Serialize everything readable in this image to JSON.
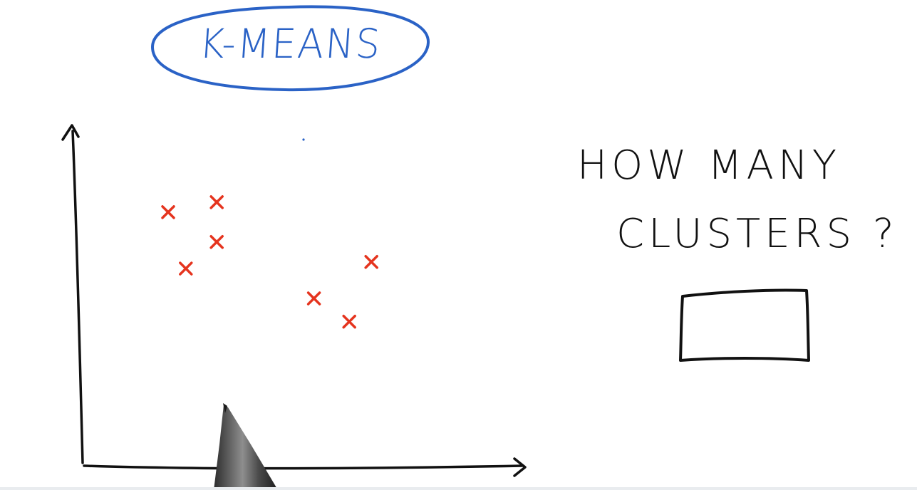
{
  "title": "K-MEANS",
  "question": {
    "line1": "HOW MANY",
    "line2": "CLUSTERS ?"
  },
  "answer_box": {
    "value": ""
  },
  "colors": {
    "title": "#2a62c6",
    "points": "#e5341e",
    "ink": "#111111"
  },
  "icons": [
    "pen-icon",
    "x-marker-icon"
  ],
  "chart_data": {
    "type": "scatter",
    "title": "",
    "xlabel": "",
    "ylabel": "",
    "xlim": [
      0,
      10
    ],
    "ylim": [
      0,
      10
    ],
    "grid": false,
    "marker": "x",
    "series": [
      {
        "values": [
          {
            "x": 2.0,
            "y": 7.6
          },
          {
            "x": 3.1,
            "y": 7.9
          },
          {
            "x": 3.1,
            "y": 6.7
          },
          {
            "x": 2.4,
            "y": 5.9
          },
          {
            "x": 5.3,
            "y": 5.0
          },
          {
            "x": 6.1,
            "y": 4.3
          },
          {
            "x": 6.6,
            "y": 6.1
          }
        ]
      }
    ]
  }
}
